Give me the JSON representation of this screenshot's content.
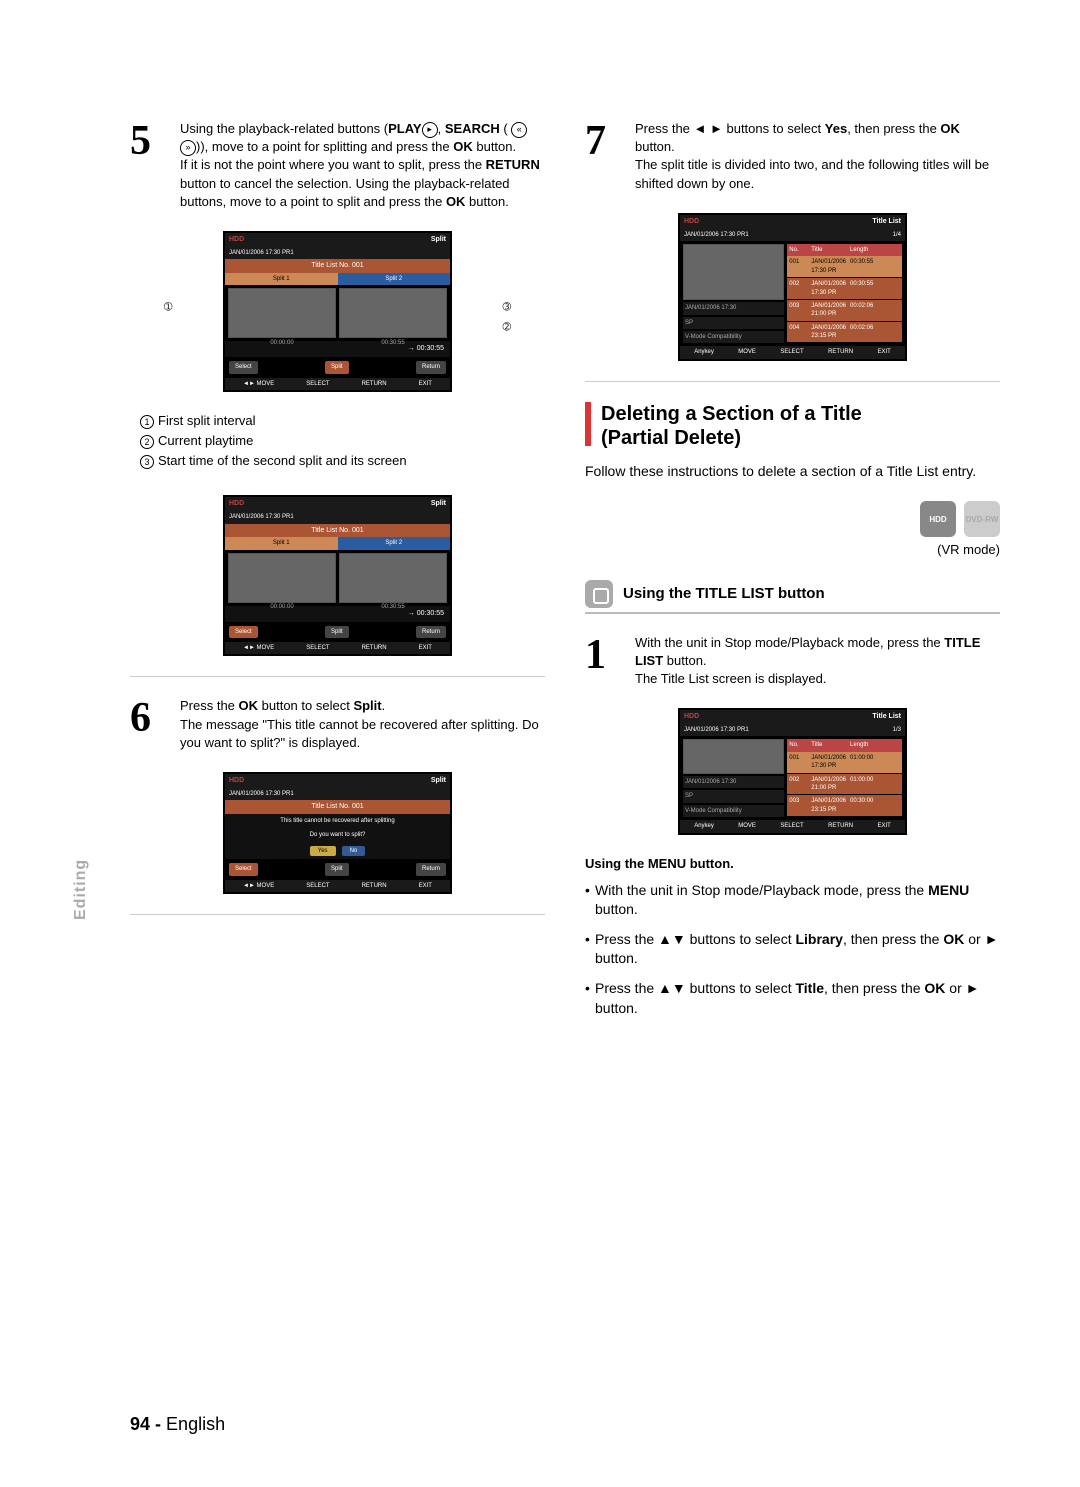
{
  "page_number": "94 -",
  "language_label": "English",
  "side_tab": "Editing",
  "left": {
    "step5": {
      "num": "5",
      "text_1": "Using the playback-related buttons (",
      "bold_play": "PLAY",
      "text_2": ", ",
      "bold_search": "SEARCH",
      "text_3": " ( ",
      "text_4": ")), move to a point for splitting and press the ",
      "bold_ok": "OK",
      "text_5": " button.",
      "para2_a": "If it is not the point where you want to split, press the ",
      "bold_return": "RETURN",
      "para2_b": " button to cancel the selection. Using the playback-related buttons, move to a point to split and press the ",
      "bold_ok2": "OK",
      "para2_c": " button."
    },
    "screen_split": {
      "hdd": "HDD",
      "right": "Split",
      "date": "JAN/01/2006 17:30 PR1",
      "header": "Title List No. 001",
      "sp1": "Split 1",
      "sp2": "Split 2",
      "time_left": "00:00:00",
      "time_right": "00:30:55",
      "progress": "→ 00:30:55",
      "btn_select": "Select",
      "btn_split": "Split",
      "btn_return": "Return",
      "foot_move": "◄► MOVE",
      "foot_select": "SELECT",
      "foot_return": "RETURN",
      "foot_exit": "EXIT"
    },
    "annotations": {
      "a1": "First split interval",
      "a2": "Current playtime",
      "a3": "Start time of the second split and its screen"
    },
    "step6": {
      "num": "6",
      "text1": "Press the ",
      "b1": "OK",
      "text2": " button to select ",
      "b2": "Split",
      "text3": ".",
      "text4": "The message \"This title cannot be recovered after splitting. Do you want to split?\" is displayed."
    },
    "screen_confirm": {
      "msg1": "This title cannot be recovered after splitting",
      "msg2": "Do you want to split?",
      "yes": "Yes",
      "no": "No"
    }
  },
  "right": {
    "step7": {
      "num": "7",
      "t1": "Press the ◄ ► buttons to select ",
      "b_yes": "Yes",
      "t2": ", then press the ",
      "b_ok": "OK",
      "t3": " button.",
      "t4": "The split title is divided into two, and the following titles will be shifted down by one."
    },
    "screen_tl4": {
      "hdd": "HDD",
      "right": "Title List",
      "date": "JAN/01/2006 17:30 PR1",
      "page": "1/4",
      "h_no": "No.",
      "h_title": "Title",
      "h_len": "Length",
      "rows": [
        {
          "no": "001",
          "title": "JAN/01/2006 17:30 PR",
          "len": "00:30:55"
        },
        {
          "no": "002",
          "title": "JAN/01/2006 17:30 PR",
          "len": "00:30:55"
        },
        {
          "no": "003",
          "title": "JAN/01/2006 21:00 PR",
          "len": "00:02:06"
        },
        {
          "no": "004",
          "title": "JAN/01/2006 23:15 PR",
          "len": "00:02:06"
        }
      ],
      "info_date": "JAN/01/2006 17:30",
      "info_sp": "SP",
      "info_vmode": "V-Mode Compatibility",
      "anykey": "Anykey",
      "foot_move": "MOVE",
      "foot_select": "SELECT",
      "foot_return": "RETURN",
      "foot_exit": "EXIT"
    },
    "section": {
      "title_l1": "Deleting a Section of a Title",
      "title_l2": "(Partial Delete)",
      "intro": "Follow these instructions to delete a section of a Title List entry."
    },
    "media": {
      "hdd": "HDD",
      "dvd": "DVD-RW",
      "mode": "(VR mode)"
    },
    "subhead": "Using the TITLE LIST button",
    "step1": {
      "num": "1",
      "t1": "With the unit in Stop mode/Playback mode, press the ",
      "b1": "TITLE LIST",
      "t2": " button.",
      "t3": "The Title List screen is displayed."
    },
    "screen_tl3": {
      "page": "1/3",
      "rows": [
        {
          "no": "001",
          "title": "JAN/01/2006 17:30 PR",
          "len": "01:00:00"
        },
        {
          "no": "002",
          "title": "JAN/01/2006 21:00 PR",
          "len": "01:00:00"
        },
        {
          "no": "003",
          "title": "JAN/01/2006 23:15 PR",
          "len": "00:30:00"
        }
      ]
    },
    "menu_head": "Using the MENU button.",
    "menu_items": {
      "i1a": "With the unit in Stop mode/Playback mode, press the ",
      "i1b": "MENU",
      "i1c": " button.",
      "i2a": "Press the ▲▼ buttons to select ",
      "i2b": "Library",
      "i2c": ", then press the ",
      "i2d": "OK",
      "i2e": " or ► button.",
      "i3a": "Press the ▲▼ buttons to select ",
      "i3b": "Title",
      "i3c": ", then press the ",
      "i3d": "OK",
      "i3e": " or ► button."
    }
  }
}
